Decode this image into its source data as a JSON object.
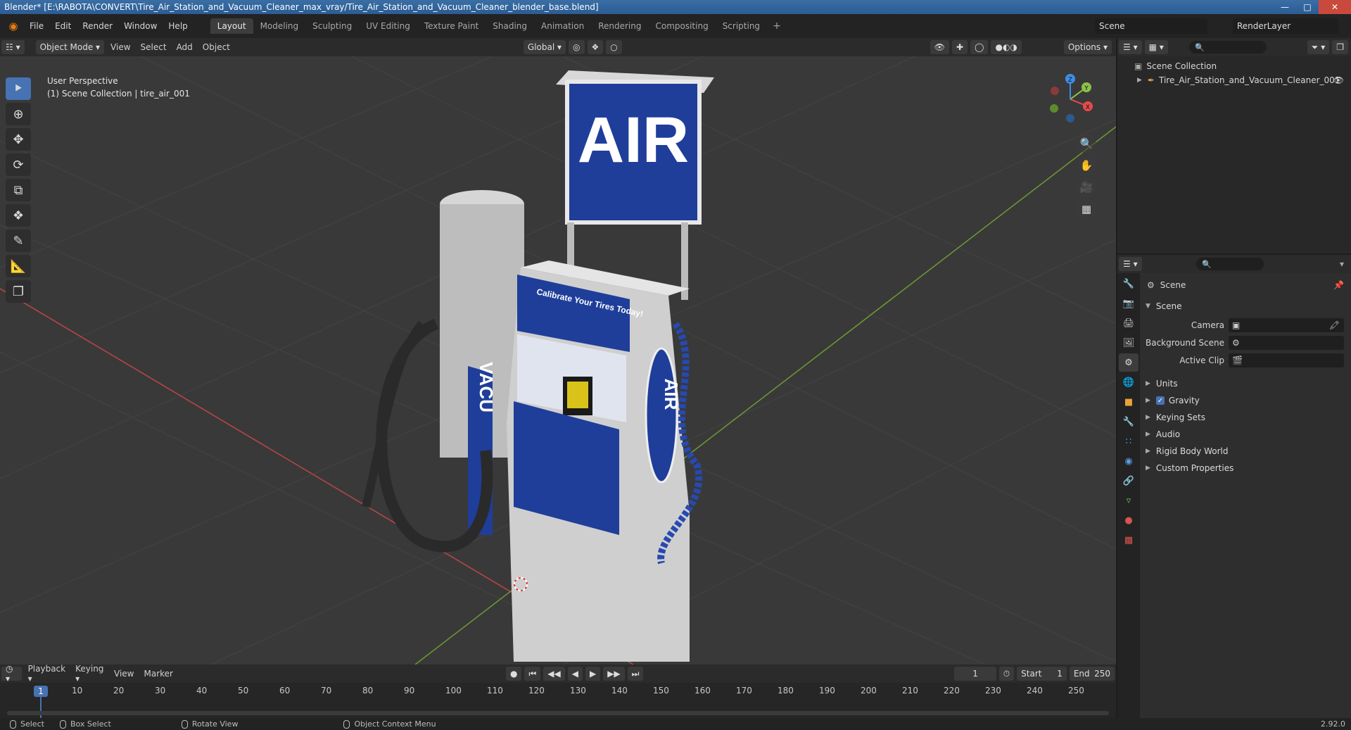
{
  "window": {
    "title": "Blender* [E:\\RABOTA\\CONVERT\\Tire_Air_Station_and_Vacuum_Cleaner_max_vray/Tire_Air_Station_and_Vacuum_Cleaner_blender_base.blend]",
    "controls": [
      "minimize-icon",
      "maximize-icon",
      "close-icon"
    ]
  },
  "menu": [
    "File",
    "Edit",
    "Render",
    "Window",
    "Help"
  ],
  "workspaces": [
    {
      "label": "Layout",
      "active": true
    },
    {
      "label": "Modeling"
    },
    {
      "label": "Sculpting"
    },
    {
      "label": "UV Editing"
    },
    {
      "label": "Texture Paint"
    },
    {
      "label": "Shading"
    },
    {
      "label": "Animation"
    },
    {
      "label": "Rendering"
    },
    {
      "label": "Compositing"
    },
    {
      "label": "Scripting"
    }
  ],
  "workspace_add": "+",
  "scene_selector": {
    "value": "Scene"
  },
  "render_layer": {
    "value": "RenderLayer"
  },
  "viewport_header": {
    "mode": "Object Mode",
    "menus": [
      "View",
      "Select",
      "Add",
      "Object"
    ],
    "transform_orientation": "Global",
    "options": "Options"
  },
  "viewport": {
    "perspective_label": "User Perspective",
    "collection_label": "(1) Scene Collection | tire_air_001",
    "gizmo_axes": [
      "X",
      "Y",
      "Z"
    ],
    "sign_text": "AIR",
    "panel_text": "Calibrate Your Tires Today!",
    "side_text": "VACU",
    "side_air_text": "AIR"
  },
  "tools": [
    "select-box-icon",
    "cursor-icon",
    "move-icon",
    "rotate-icon",
    "scale-icon",
    "transform-icon",
    "annotate-icon",
    "measure-icon",
    "add-cube-icon"
  ],
  "timeline": {
    "menus": [
      "Playback",
      "Keying",
      "View",
      "Marker"
    ],
    "current_frame": "1",
    "start_label": "Start",
    "start": "1",
    "end_label": "End",
    "end": "250",
    "ticks": [
      "10",
      "20",
      "30",
      "40",
      "50",
      "60",
      "70",
      "80",
      "90",
      "100",
      "110",
      "120",
      "130",
      "140",
      "150",
      "160",
      "170",
      "180",
      "190",
      "200",
      "210",
      "220",
      "230",
      "240",
      "250"
    ],
    "playhead_label": "1"
  },
  "status": {
    "select": "Select",
    "box_select": "Box Select",
    "rotate_view": "Rotate View",
    "context_menu": "Object Context Menu",
    "version": "2.92.0"
  },
  "outliner": {
    "root": "Scene Collection",
    "items": [
      {
        "label": "Tire_Air_Station_and_Vacuum_Cleaner_001"
      }
    ]
  },
  "properties": {
    "context_title": "Scene",
    "section": "Scene",
    "fields": [
      {
        "label": "Camera",
        "value": ""
      },
      {
        "label": "Background Scene",
        "value": ""
      },
      {
        "label": "Active Clip",
        "value": ""
      }
    ],
    "panels": [
      {
        "label": "Units"
      },
      {
        "label": "Gravity",
        "checked": true
      },
      {
        "label": "Keying Sets"
      },
      {
        "label": "Audio"
      },
      {
        "label": "Rigid Body World"
      },
      {
        "label": "Custom Properties"
      }
    ]
  },
  "colors": {
    "accent": "#4772b3",
    "x_axis": "#e74b4b",
    "y_axis": "#8bc34a",
    "z_axis": "#3c8fe8",
    "sign_blue": "#1f3e9a"
  }
}
